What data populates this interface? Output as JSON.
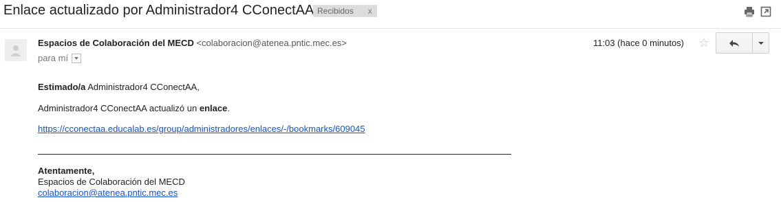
{
  "message": {
    "subject": "Enlace actualizado por Administrador4 CConectAA",
    "label": "Recibidos",
    "label_remove": "x",
    "sender_name": "Espacios de Colaboración del MECD",
    "sender_email": "<colaboracion@atenea.pntic.mec.es>",
    "to_label": "para mí",
    "timestamp": "11:03 (hace 0 minutos)"
  },
  "icons": {
    "print": "print-icon",
    "new_window": "new-window-icon",
    "star": "star-icon",
    "reply": "reply-icon",
    "more": "chevron-down-icon",
    "avatar": "avatar-placeholder-icon"
  },
  "body": {
    "greeting_bold": "Estimado/a",
    "greeting_rest": " Administrador4 CConectAA,",
    "line2_pre": "Administrador4 CConectAA actualizó un ",
    "line2_bold": "enlace",
    "line2_post": ".",
    "link": "https://cconectaa.educalab.es/group/administradores/enlaces/-/bookmarks/609045"
  },
  "signature": {
    "closing": "Atentamente,",
    "org": "Espacios de Colaboración del MECD",
    "email": "colaboracion@atenea.pntic.mec.es"
  },
  "colors": {
    "link": "#1155cc",
    "label_bg": "#dddddd",
    "text": "#222222"
  }
}
